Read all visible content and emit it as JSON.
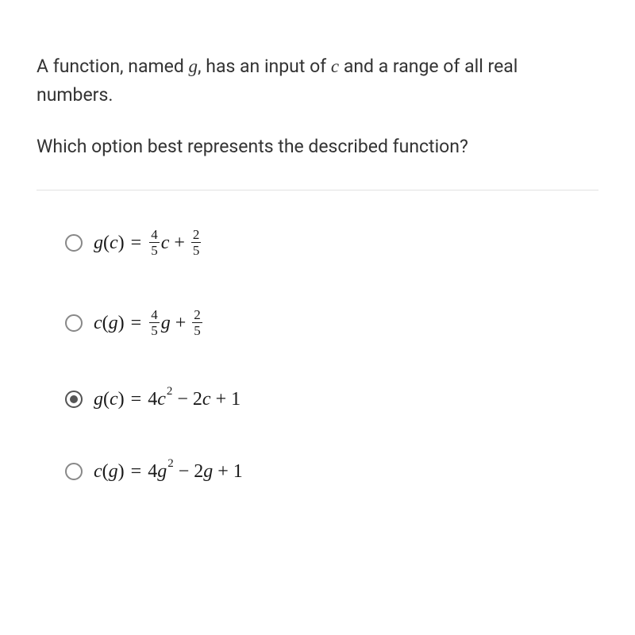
{
  "prompt": {
    "part1": "A function, named ",
    "var1": "g",
    "part2": ", has an input of ",
    "var2": "c",
    "part3": " and a range of all real numbers."
  },
  "question": "Which option best represents the described function?",
  "options": [
    {
      "id": "opt-a",
      "selected": false,
      "func": "g",
      "arg": "c",
      "expr_type": "linear_frac",
      "a_num": "4",
      "a_den": "5",
      "var": "c",
      "b_num": "2",
      "b_den": "5",
      "display": "g(c) = (4/5)c + 2/5"
    },
    {
      "id": "opt-b",
      "selected": false,
      "func": "c",
      "arg": "g",
      "expr_type": "linear_frac",
      "a_num": "4",
      "a_den": "5",
      "var": "g",
      "b_num": "2",
      "b_den": "5",
      "display": "c(g) = (4/5)g + 2/5"
    },
    {
      "id": "opt-c",
      "selected": true,
      "func": "g",
      "arg": "c",
      "expr_type": "quadratic",
      "a": "4",
      "var": "c",
      "b": "2",
      "c": "1",
      "display": "g(c) = 4c^2 - 2c + 1"
    },
    {
      "id": "opt-d",
      "selected": false,
      "func": "c",
      "arg": "g",
      "expr_type": "quadratic",
      "a": "4",
      "var": "g",
      "b": "2",
      "c": "1",
      "display": "c(g) = 4g^2 - 2g + 1"
    }
  ]
}
